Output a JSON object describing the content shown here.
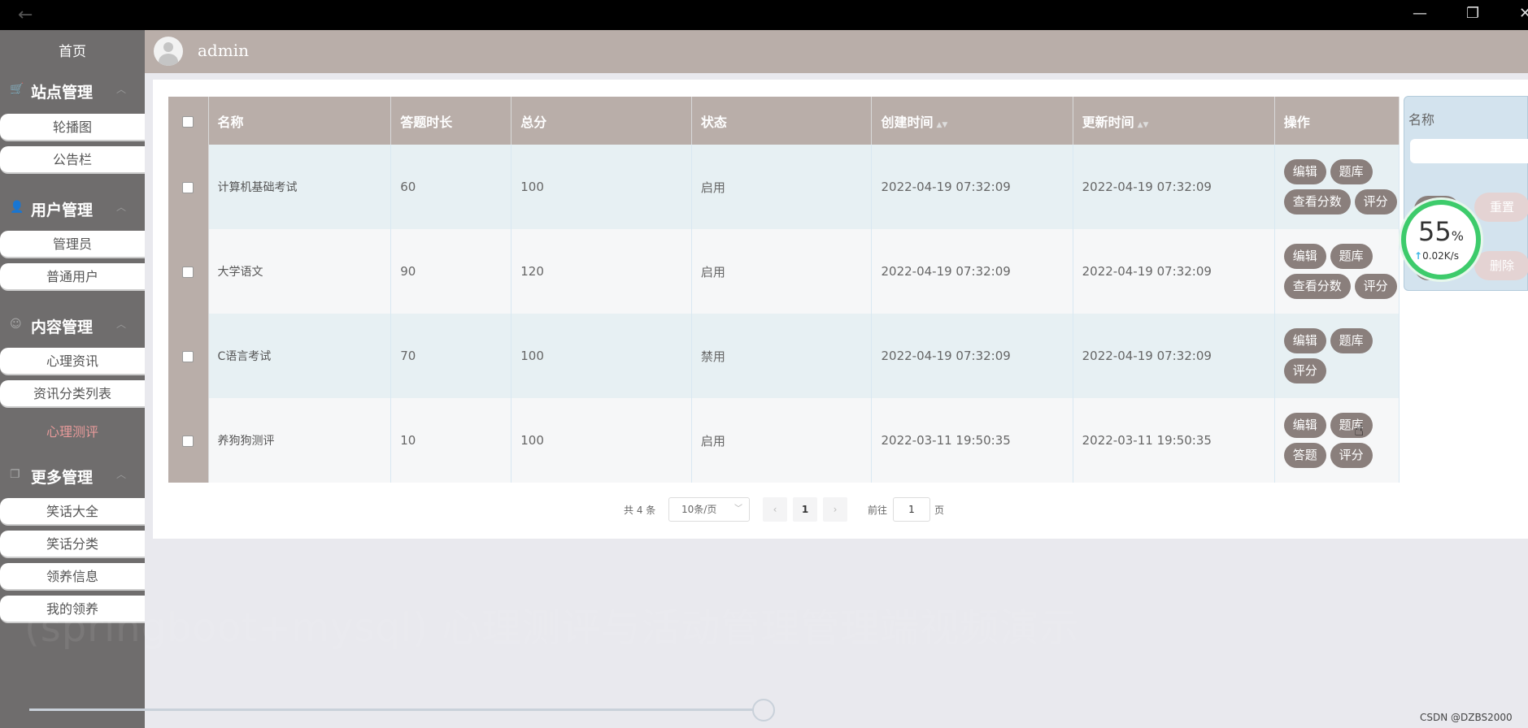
{
  "header": {
    "username": "admin"
  },
  "sidebar": {
    "home": "首页",
    "groups": [
      {
        "label": "站点管理",
        "items": [
          "轮播图",
          "公告栏"
        ]
      },
      {
        "label": "用户管理",
        "items": [
          "管理员",
          "普通用户"
        ]
      },
      {
        "label": "内容管理",
        "items": [
          "心理资讯",
          "资讯分类列表",
          "心理测评"
        ]
      },
      {
        "label": "更多管理",
        "items": [
          "笑话大全",
          "笑话分类",
          "领养信息",
          "我的领养"
        ]
      }
    ],
    "active_item": "心理测评"
  },
  "table": {
    "columns": [
      "名称",
      "答题时长",
      "总分",
      "状态",
      "创建时间",
      "更新时间",
      "操作"
    ],
    "rows": [
      {
        "name": "计算机基础考试",
        "duration": "60",
        "total": "100",
        "status": "启用",
        "created": "2022-04-19 07:32:09",
        "updated": "2022-04-19 07:32:09",
        "actions": [
          "编辑",
          "题库",
          "查看分数",
          "评分"
        ]
      },
      {
        "name": "大学语文",
        "duration": "90",
        "total": "120",
        "status": "启用",
        "created": "2022-04-19 07:32:09",
        "updated": "2022-04-19 07:32:09",
        "actions": [
          "编辑",
          "题库",
          "查看分数",
          "评分"
        ]
      },
      {
        "name": "C语言考试",
        "duration": "70",
        "total": "100",
        "status": "禁用",
        "created": "2022-04-19 07:32:09",
        "updated": "2022-04-19 07:32:09",
        "actions": [
          "编辑",
          "题库",
          "评分"
        ]
      },
      {
        "name": "养狗狗测评",
        "duration": "10",
        "total": "100",
        "status": "启用",
        "created": "2022-03-11 19:50:35",
        "updated": "2022-03-11 19:50:35",
        "actions": [
          "编辑",
          "题库",
          "答题",
          "评分"
        ]
      }
    ]
  },
  "pagination": {
    "total": "共 4 条",
    "page_size": "10条/页",
    "current_page": "1",
    "goto_label": "前往",
    "goto_value": "1",
    "page_suffix": "页"
  },
  "search_panel": {
    "name_label": "名称",
    "reset_label": "重置",
    "delete_label": "删除"
  },
  "speed_widget": {
    "percent": "55",
    "percent_unit": "%",
    "rate": "0.02K/s"
  },
  "watermark": "(springboot+mysql) 心理测评与活动管理管理端视频演示",
  "credit": "CSDN @DZBS2000",
  "colors": {
    "accent": "#b9aea9",
    "button": "#8a7f7c",
    "active_menu": "#e79a9a",
    "sidebar": "#6f6d6d"
  }
}
